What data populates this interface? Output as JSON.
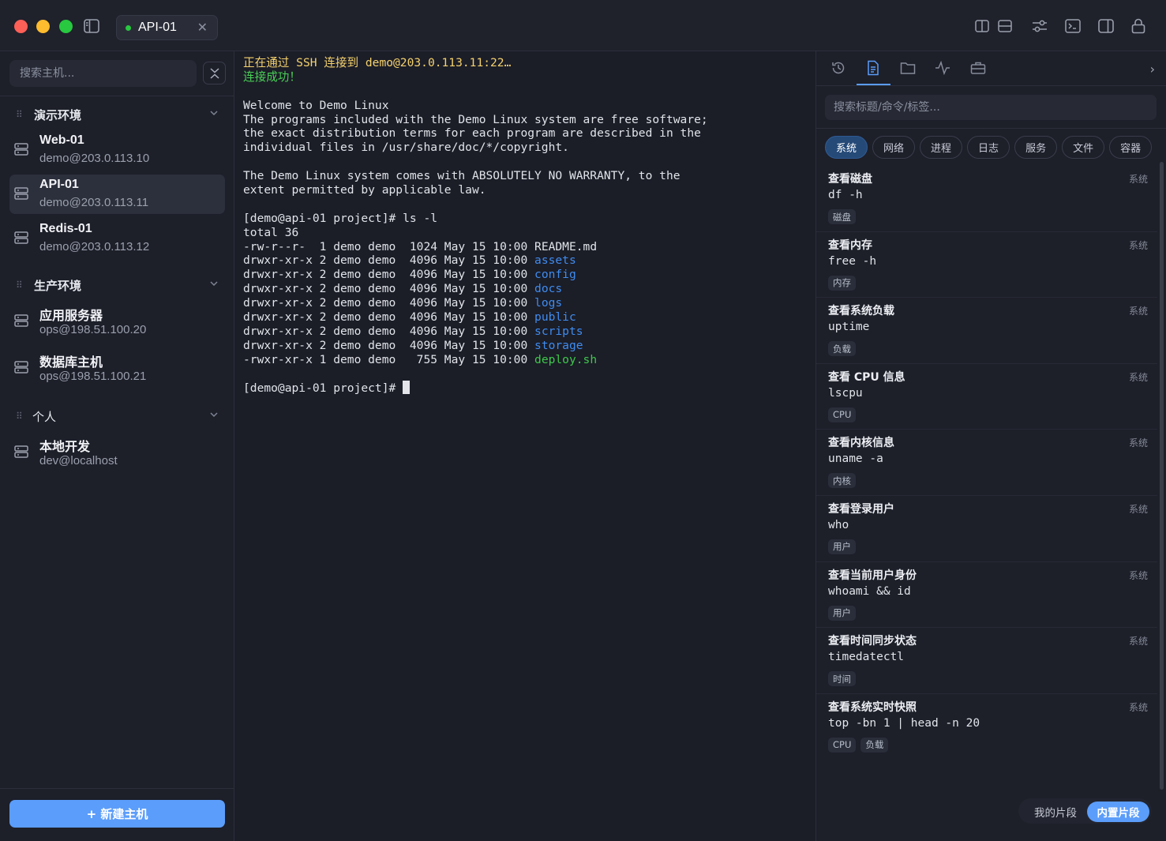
{
  "window": {
    "tab": {
      "label": "API-01",
      "status_color": "#28c840"
    }
  },
  "sidebar": {
    "search_placeholder": "搜索主机...",
    "groups": [
      {
        "label": "演示环境",
        "hosts": [
          {
            "name": "Web-01",
            "address": "demo@203.0.113.10"
          },
          {
            "name": "API-01",
            "address": "demo@203.0.113.11",
            "active": true
          },
          {
            "name": "Redis-01",
            "address": "demo@203.0.113.12"
          }
        ]
      },
      {
        "label": "生产环境",
        "hosts": [
          {
            "name": "应用服务器",
            "address": "ops@198.51.100.20"
          },
          {
            "name": "数据库主机",
            "address": "ops@198.51.100.21"
          }
        ]
      },
      {
        "label": "个人",
        "hosts": [
          {
            "name": "本地开发",
            "address": "dev@localhost"
          }
        ]
      }
    ],
    "new_host_label": "+ 新建主机"
  },
  "terminal": {
    "connecting": "正在通过 SSH 连接到 demo@203.0.113.11:22…",
    "connected": "连接成功！",
    "motd": [
      "Welcome to Demo Linux",
      "The programs included with the Demo Linux system are free software;",
      "the exact distribution terms for each program are described in the",
      "individual files in /usr/share/doc/*/copyright.",
      "",
      "The Demo Linux system comes with ABSOLUTELY NO WARRANTY, to the",
      "extent permitted by applicable law."
    ],
    "command_line": "[demo@api-01 project]# ls -l",
    "total": "total 36",
    "listing": [
      {
        "meta": "-rw-r--r-  1 demo demo  1024 May 15 10:00 ",
        "name": "README.md",
        "kind": "file"
      },
      {
        "meta": "drwxr-xr-x 2 demo demo  4096 May 15 10:00 ",
        "name": "assets",
        "kind": "dir"
      },
      {
        "meta": "drwxr-xr-x 2 demo demo  4096 May 15 10:00 ",
        "name": "config",
        "kind": "dir"
      },
      {
        "meta": "drwxr-xr-x 2 demo demo  4096 May 15 10:00 ",
        "name": "docs",
        "kind": "dir"
      },
      {
        "meta": "drwxr-xr-x 2 demo demo  4096 May 15 10:00 ",
        "name": "logs",
        "kind": "dir"
      },
      {
        "meta": "drwxr-xr-x 2 demo demo  4096 May 15 10:00 ",
        "name": "public",
        "kind": "dir"
      },
      {
        "meta": "drwxr-xr-x 2 demo demo  4096 May 15 10:00 ",
        "name": "scripts",
        "kind": "dir"
      },
      {
        "meta": "drwxr-xr-x 2 demo demo  4096 May 15 10:00 ",
        "name": "storage",
        "kind": "dir"
      },
      {
        "meta": "-rwxr-xr-x 1 demo demo   755 May 15 10:00 ",
        "name": "deploy.sh",
        "kind": "exec"
      }
    ],
    "prompt": "[demo@api-01 project]# "
  },
  "snippets": {
    "search_placeholder": "搜索标题/命令/标签...",
    "categories": [
      "系统",
      "网络",
      "进程",
      "日志",
      "服务",
      "文件",
      "容器"
    ],
    "active_category": "系统",
    "items": [
      {
        "title": "查看磁盘",
        "category": "系统",
        "command": "df -h",
        "tags": [
          "磁盘"
        ]
      },
      {
        "title": "查看内存",
        "category": "系统",
        "command": "free -h",
        "tags": [
          "内存"
        ]
      },
      {
        "title": "查看系统负载",
        "category": "系统",
        "command": "uptime",
        "tags": [
          "负载"
        ]
      },
      {
        "title": "查看 CPU 信息",
        "category": "系统",
        "command": "lscpu",
        "tags": [
          "CPU"
        ]
      },
      {
        "title": "查看内核信息",
        "category": "系统",
        "command": "uname -a",
        "tags": [
          "内核"
        ]
      },
      {
        "title": "查看登录用户",
        "category": "系统",
        "command": "who",
        "tags": [
          "用户"
        ]
      },
      {
        "title": "查看当前用户身份",
        "category": "系统",
        "command": "whoami && id",
        "tags": [
          "用户"
        ]
      },
      {
        "title": "查看时间同步状态",
        "category": "系统",
        "command": "timedatectl",
        "tags": [
          "时间"
        ]
      },
      {
        "title": "查看系统实时快照",
        "category": "系统",
        "command": "top -bn 1 | head -n 20",
        "tags": [
          "CPU",
          "负载"
        ]
      }
    ],
    "source_toggle": {
      "mine": "我的片段",
      "builtin": "内置片段",
      "selected": "builtin"
    }
  },
  "colors": {
    "accent": "#5b9dfa",
    "terminal_dir": "#3f8cf0",
    "terminal_exec": "#3ec84b",
    "terminal_warn": "#f5d26e",
    "terminal_ok": "#49cf56"
  },
  "icons": {
    "titlebar_right": [
      "split-vertical-icon",
      "split-horizontal-icon",
      "sliders-icon",
      "terminal-icon",
      "right-panel-icon",
      "lock-icon"
    ],
    "right_tabs": [
      "history-icon",
      "snippet-icon",
      "folder-icon",
      "activity-icon",
      "toolbox-icon"
    ]
  }
}
